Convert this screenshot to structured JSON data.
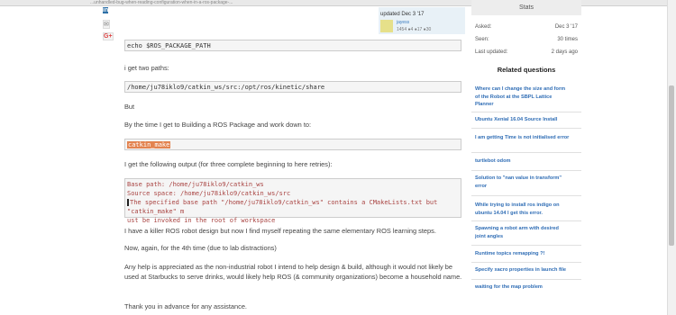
{
  "browser": {
    "url_fragment": "...unhandled-bug-when-reading-configuration-when-in-a-ros-package-..."
  },
  "share": {
    "linkedin": "in",
    "email": "✉",
    "gplus": "G+"
  },
  "post_card": {
    "updated": "updated Dec 3 '17",
    "user": "jayess",
    "rep": "1454 ●4 ●17 ●30"
  },
  "content": {
    "code1": "echo $ROS_PACKAGE_PATH",
    "p1": "i get two paths:",
    "code2": "/home/ju78iklo9/catkin_ws/src:/opt/ros/kinetic/share",
    "p2": "But",
    "p3": "By the time I get to Building a ROS Package and work down to:",
    "code3": "catkin_make",
    "p4": "I get the following output (for three complete beginning to here retries):",
    "code4_l1": "Base path: /home/ju78iklo9/catkin_ws",
    "code4_l2": "Source space: /home/ju78iklo9/catkin_ws/src",
    "code4_l3": "The specified base path \"/home/ju78iklo9/catkin_ws\" contains a CMakeLists.txt but \"catkin_make\" m",
    "code4_l4": "ust be invoked in the root of workspace",
    "p5": "I have a killer ROS robot design but now I find myself repeating the same elementary ROS learning steps.",
    "p6": "Now, again, for the 4th time (due to lab distractions)",
    "p7": "Any help is appreciated as the non-industrial robot I intend to help design & build, although it would not likely be used at Starbucks to serve drinks, would likely help ROS (& community organizations) become a household name.",
    "p8": "Thank you in advance for any assistance."
  },
  "sidebar": {
    "stats_title": "Stats",
    "asked_label": "Asked:",
    "asked_value": "Dec 3 '17",
    "seen_label": "Seen:",
    "seen_value": "30 times",
    "updated_label": "Last updated:",
    "updated_value": "2 days ago",
    "related_title": "Related questions",
    "related": [
      "Where can I change the size and form of the Robot at the SBPL Lattice Planner",
      "Ubuntu Xenial 16.04 Source Install",
      "I am getting Time is not initialised error",
      "turtlebot odom",
      "Solution to \"nan value in transform\" error",
      "While trying to install ros indigo on ubuntu 14.04 I get this error.",
      "Spawning a robot arm with desired joint angles",
      "Runtime topics remapping ?!",
      "Specify xacro properties in launch file",
      "waiting for the map problem"
    ]
  },
  "colors": {
    "link": "#2f6db5",
    "highlight": "#e3834f",
    "code_bg": "#f5f5f5"
  }
}
